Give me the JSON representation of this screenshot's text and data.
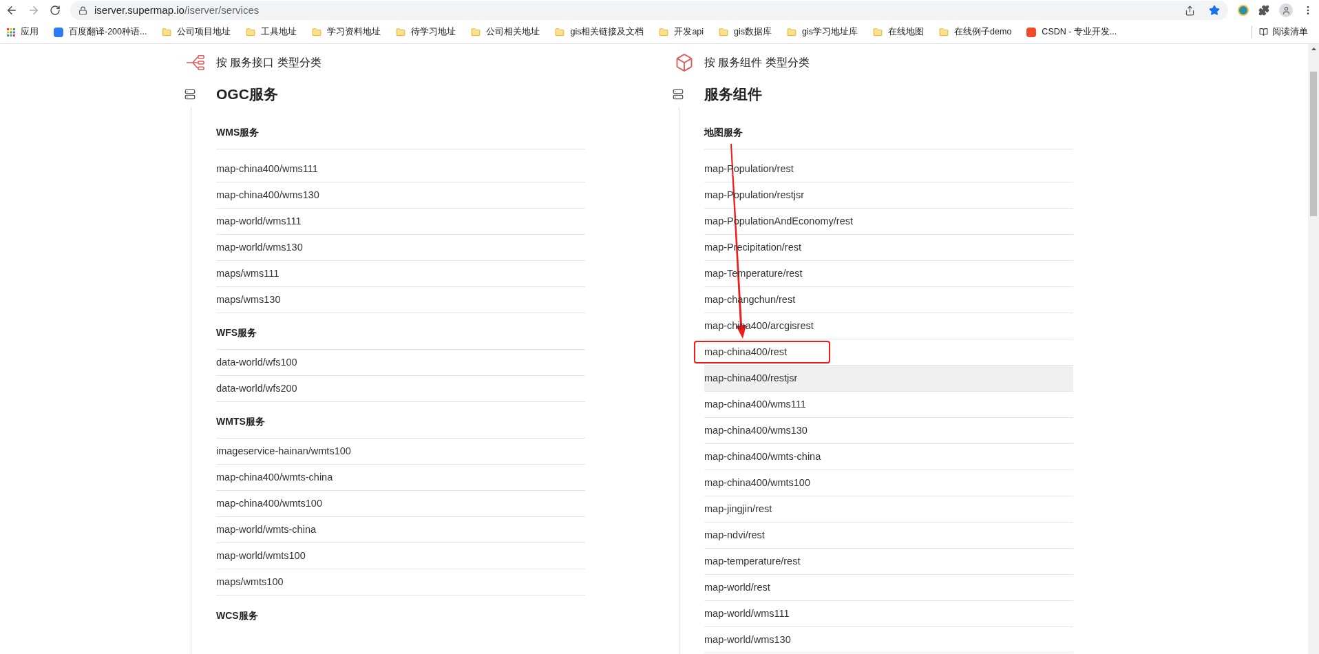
{
  "browser": {
    "url_host": "iserver.supermap.io",
    "url_path": "/iserver/services",
    "reading_list": "阅读清单",
    "bookmarks": [
      {
        "label": "应用",
        "kind": "apps"
      },
      {
        "label": "百度翻译-200种语...",
        "kind": "translate"
      },
      {
        "label": "公司项目地址",
        "kind": "folder"
      },
      {
        "label": "工具地址",
        "kind": "folder"
      },
      {
        "label": "学习资料地址",
        "kind": "folder"
      },
      {
        "label": "待学习地址",
        "kind": "folder"
      },
      {
        "label": "公司相关地址",
        "kind": "folder"
      },
      {
        "label": "gis相关链接及文档",
        "kind": "folder"
      },
      {
        "label": "开发api",
        "kind": "folder"
      },
      {
        "label": "gis数据库",
        "kind": "folder"
      },
      {
        "label": "gis学习地址库",
        "kind": "folder"
      },
      {
        "label": "在线地图",
        "kind": "folder"
      },
      {
        "label": "在线例子demo",
        "kind": "folder"
      },
      {
        "label": "CSDN - 专业开发...",
        "kind": "csdn"
      }
    ]
  },
  "columns": [
    {
      "kind": "interface",
      "category": "按 服务接口 类型分类",
      "title": "OGC服务",
      "sections": [
        {
          "title": "WMS服务",
          "items": [
            {
              "label": "map-china400/wms111",
              "selected": false,
              "boxed": false
            },
            {
              "label": "map-china400/wms130",
              "selected": false,
              "boxed": false
            },
            {
              "label": "map-world/wms111",
              "selected": false,
              "boxed": false
            },
            {
              "label": "map-world/wms130",
              "selected": false,
              "boxed": false
            },
            {
              "label": "maps/wms111",
              "selected": false,
              "boxed": false
            },
            {
              "label": "maps/wms130",
              "selected": false,
              "boxed": false
            }
          ]
        },
        {
          "title": "WFS服务",
          "items": [
            {
              "label": "data-world/wfs100",
              "selected": false,
              "boxed": false
            },
            {
              "label": "data-world/wfs200",
              "selected": false,
              "boxed": false
            }
          ]
        },
        {
          "title": "WMTS服务",
          "items": [
            {
              "label": "imageservice-hainan/wmts100",
              "selected": false,
              "boxed": false
            },
            {
              "label": "map-china400/wmts-china",
              "selected": false,
              "boxed": false
            },
            {
              "label": "map-china400/wmts100",
              "selected": false,
              "boxed": false
            },
            {
              "label": "map-world/wmts-china",
              "selected": false,
              "boxed": false
            },
            {
              "label": "map-world/wmts100",
              "selected": false,
              "boxed": false
            },
            {
              "label": "maps/wmts100",
              "selected": false,
              "boxed": false
            }
          ]
        },
        {
          "title": "WCS服务"
        }
      ]
    },
    {
      "kind": "component",
      "category": "按 服务组件 类型分类",
      "title": "服务组件",
      "sections": [
        {
          "title": "地图服务",
          "items": [
            {
              "label": "map-Population/rest",
              "selected": false,
              "boxed": false
            },
            {
              "label": "map-Population/restjsr",
              "selected": false,
              "boxed": false
            },
            {
              "label": "map-PopulationAndEconomy/rest",
              "selected": false,
              "boxed": false
            },
            {
              "label": "map-Precipitation/rest",
              "selected": false,
              "boxed": false
            },
            {
              "label": "map-Temperature/rest",
              "selected": false,
              "boxed": false
            },
            {
              "label": "map-changchun/rest",
              "selected": false,
              "boxed": false
            },
            {
              "label": "map-china400/arcgisrest",
              "selected": false,
              "boxed": false
            },
            {
              "label": "map-china400/rest",
              "selected": false,
              "boxed": true
            },
            {
              "label": "map-china400/restjsr",
              "selected": true,
              "boxed": false
            },
            {
              "label": "map-china400/wms111",
              "selected": false,
              "boxed": false
            },
            {
              "label": "map-china400/wms130",
              "selected": false,
              "boxed": false
            },
            {
              "label": "map-china400/wmts-china",
              "selected": false,
              "boxed": false
            },
            {
              "label": "map-china400/wmts100",
              "selected": false,
              "boxed": false
            },
            {
              "label": "map-jingjin/rest",
              "selected": false,
              "boxed": false
            },
            {
              "label": "map-ndvi/rest",
              "selected": false,
              "boxed": false
            },
            {
              "label": "map-temperature/rest",
              "selected": false,
              "boxed": false
            },
            {
              "label": "map-world/rest",
              "selected": false,
              "boxed": false
            },
            {
              "label": "map-world/wms111",
              "selected": false,
              "boxed": false
            },
            {
              "label": "map-world/wms130",
              "selected": false,
              "boxed": false
            }
          ]
        }
      ]
    }
  ]
}
